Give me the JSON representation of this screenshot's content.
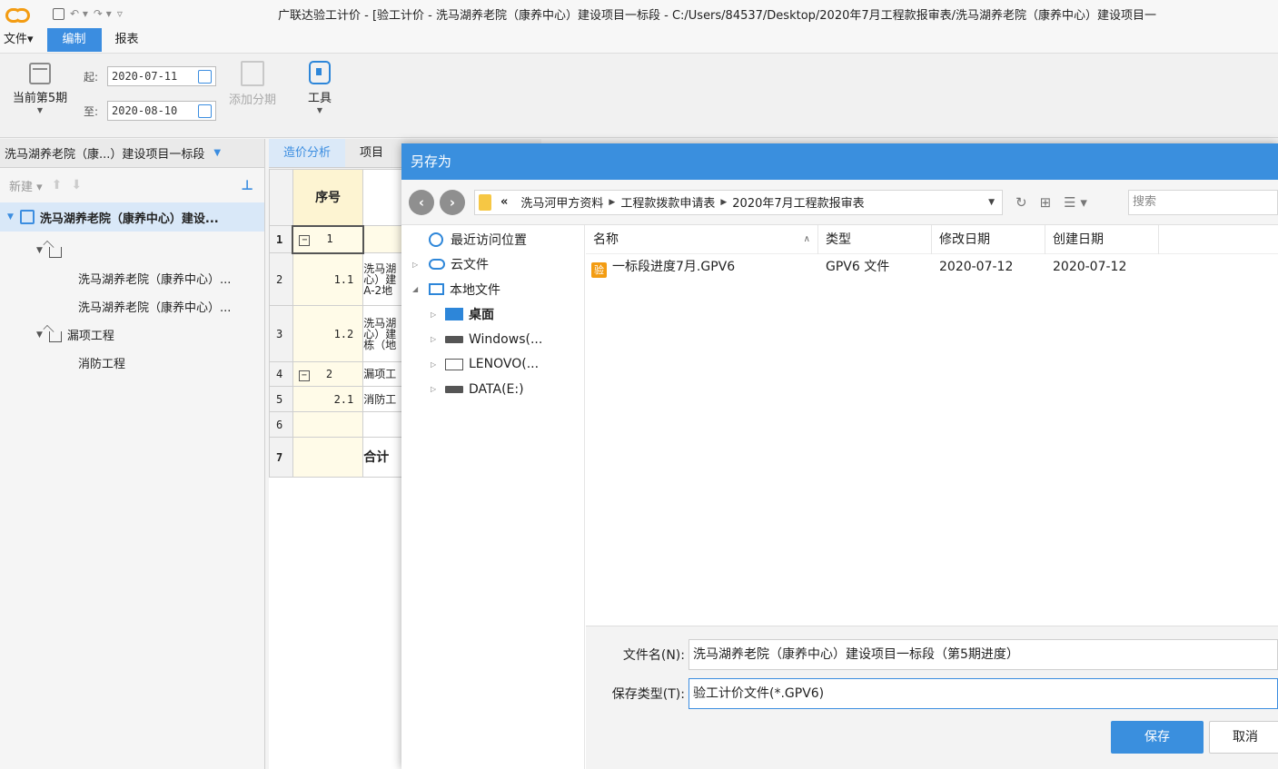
{
  "app": {
    "window_title": "广联达验工计价 - [验工计价 - 洗马湖养老院（康养中心）建设项目一标段 - C:/Users/84537/Desktop/2020年7月工程款报审表/洗马湖养老院（康养中心）建设项目一",
    "quick_access": {
      "undo": "↶ ▾",
      "redo": "↷ ▾",
      "customize": "▿"
    }
  },
  "menu": {
    "file": "文件▾",
    "edit": "编制",
    "report": "报表"
  },
  "ribbon": {
    "period_label": "当前第5期",
    "start_label": "起:",
    "start_date": "2020-07-11",
    "end_label": "至:",
    "end_date": "2020-08-10",
    "add_period": "添加分期",
    "tools": "工具"
  },
  "left_panel": {
    "project_selector": "洗马湖养老院（康...）建设项目一标段",
    "new_label": "新建 ▾",
    "root": "洗马湖养老院（康养中心）建设...",
    "children": [
      "洗马湖养老院（康养中心）...",
      "洗马湖养老院（康养中心）..."
    ],
    "node_leak": "漏项工程",
    "node_fire": "消防工程"
  },
  "grid": {
    "tabs": [
      "造价分析",
      "项目"
    ],
    "header_seq": "序号",
    "rows": [
      {
        "rn": "1",
        "seq": "1",
        "name": ""
      },
      {
        "rn": "2",
        "seq": "1.1",
        "name": "洗马湖心）建A-2地"
      },
      {
        "rn": "3",
        "seq": "1.2",
        "name": "洗马湖心）建栋（地"
      },
      {
        "rn": "4",
        "seq": "2",
        "name": "漏项工"
      },
      {
        "rn": "5",
        "seq": "2.1",
        "name": "消防工"
      },
      {
        "rn": "6",
        "seq": "",
        "name": ""
      },
      {
        "rn": "7",
        "seq": "",
        "name": "合计"
      }
    ]
  },
  "dialog": {
    "title": "另存为",
    "path": [
      "洗马河甲方资料",
      "工程款拨款申请表",
      "2020年7月工程款报审表"
    ],
    "path_prefix": "«",
    "search_placeholder": "搜索",
    "tree": {
      "recent": "最近访问位置",
      "cloud": "云文件",
      "local": "本地文件",
      "desktop": "桌面",
      "windows": "Windows(...",
      "lenovo": "LENOVO(...",
      "data": "DATA(E:)"
    },
    "columns": {
      "name": "名称",
      "type": "类型",
      "modified": "修改日期",
      "created": "创建日期"
    },
    "files": [
      {
        "icon_text": "验",
        "name": "一标段进度7月.GPV6",
        "type": "GPV6 文件",
        "modified": "2020-07-12",
        "created": "2020-07-12"
      }
    ],
    "filename_label": "文件名(N):",
    "filename_value": "洗马湖养老院（康养中心）建设项目一标段（第5期进度）",
    "filetype_label": "保存类型(T):",
    "filetype_value": "验工计价文件(*.GPV6)",
    "save": "保存",
    "cancel": "取消"
  }
}
